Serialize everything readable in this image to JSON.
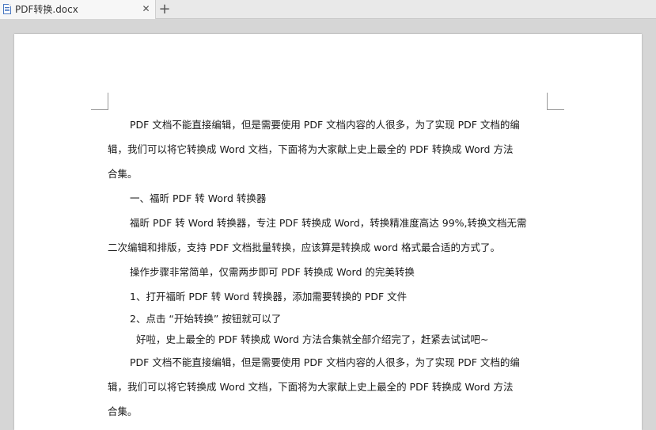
{
  "tabbar": {
    "tab_title": "PDF转换.docx",
    "close_glyph": "✕",
    "new_tab_glyph": "+"
  },
  "document": {
    "lines": [
      "PDF 文档不能直接编辑，但是需要使用 PDF 文档内容的人很多，为了实现 PDF 文档的编",
      "辑，我们可以将它转换成 Word 文档，下面将为大家献上史上最全的 PDF 转换成 Word 方法",
      "合集。",
      "一、福昕 PDF 转 Word 转换器",
      "福昕 PDF 转 Word 转换器，专注 PDF 转换成 Word，转换精准度高达 99%,转换文档无需",
      "二次编辑和排版，支持 PDF 文档批量转换，应该算是转换成 word 格式最合适的方式了。",
      "操作步骤非常简单，仅需两步即可 PDF 转换成 Word 的完美转换",
      "1、打开福昕 PDF 转 Word 转换器，添加需要转换的 PDF 文件",
      "2、点击 “开始转换” 按钮就可以了",
      "好啦，史上最全的 PDF 转换成 Word 方法合集就全部介绍完了，赶紧去试试吧~",
      "PDF 文档不能直接编辑，但是需要使用 PDF 文档内容的人很多，为了实现 PDF 文档的编",
      "辑，我们可以将它转换成 Word 文档，下面将为大家献上史上最全的 PDF 转换成 Word 方法",
      "合集。"
    ]
  },
  "icons": {
    "doc": "word-document-icon",
    "close": "close-icon",
    "new_tab": "plus-icon"
  }
}
